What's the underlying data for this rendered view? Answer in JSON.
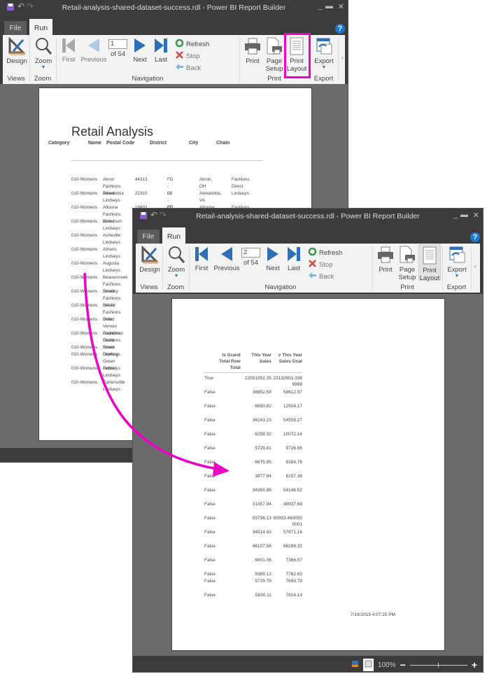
{
  "colors": {
    "accent": "#ee00c8",
    "nav_blue": "#2f6fb5",
    "chrome": "#3b3b3b",
    "ribbon": "#f3f3f3"
  },
  "back": {
    "title": "Retail-analysis-shared-dataset-success.rdl  -  Power  BI  Report  Builder",
    "tabs": {
      "file": "File",
      "run": "Run"
    },
    "ribbon": {
      "design": "Design",
      "zoom": "Zoom",
      "first": "First",
      "previous": "Previous",
      "page": "1",
      "of": "of  54",
      "next": "Next",
      "last": "Last",
      "refresh": "Refresh",
      "stop": "Stop",
      "back": "Back",
      "print": "Print",
      "page_setup": "Page\nSetup",
      "print_layout": "Print\nLayout",
      "export": "Export",
      "groups": {
        "views": "Views",
        "zoom": "Zoom",
        "navigation": "Navigation",
        "print": "Print",
        "export": "Export"
      }
    },
    "report": {
      "title": "Retail Analysis",
      "headers": [
        "Category",
        "Name",
        "Postal Code",
        "District",
        "City",
        "Chain"
      ],
      "rows": [
        [
          "010-Womens",
          "Akron\nFashions Direct",
          "44313",
          "FD - 03",
          "Akron, OH",
          "Fashions Direct"
        ],
        [
          "010-Womens",
          "Alexandria\nLindseys",
          "22310",
          "LI - 02",
          "Alexandria, VA",
          "Lindseys"
        ],
        [
          "010-Womens",
          "Altoona\nFashions Direct",
          "16602",
          "FD - 01",
          "Altoona, PA",
          "Fashions Direct"
        ],
        [
          "010-Womens",
          "Anderson\nLindseys"
        ],
        [
          "010-Womens",
          "Asheville\nLindseys"
        ],
        [
          "010-Womens",
          "Athens\nLindseys"
        ],
        [
          "010-Womens",
          "Augusta\nLindseys"
        ],
        [
          "010-Womens",
          "Beavercreek\nFashions Direct"
        ],
        [
          "010-Womens",
          "Beckley\nFashions Direct"
        ],
        [
          "010-Womens",
          "Bel Air\nFashions Direct"
        ],
        [
          "010-Womens",
          "Belle Vernon\nFashions Direct"
        ],
        [
          "010-Womens",
          "Boardman\nFashions Direct"
        ],
        [
          "010-Womens",
          "Bowie Lindseys"
        ],
        [
          "010-Womens",
          "Bowling Green\nLindseys"
        ],
        [
          "010-Womens",
          "Buford\nLindseys"
        ],
        [
          "010-Womens",
          "Cartersville\nLindseys"
        ]
      ]
    }
  },
  "front": {
    "title": "Retail-analysis-shared-dataset-success.rdl  -  Power  BI  Report  Builder",
    "tabs": {
      "file": "File",
      "run": "Run"
    },
    "ribbon": {
      "design": "Design",
      "zoom": "Zoom",
      "first": "First",
      "previous": "Previous",
      "page": "2",
      "of": "of  54",
      "next": "Next",
      "last": "Last",
      "refresh": "Refresh",
      "stop": "Stop",
      "back": "Back",
      "print": "Print",
      "page_setup": "Page\nSetup",
      "print_layout": "Print\nLayout",
      "export": "Export",
      "groups": {
        "views": "Views",
        "zoom": "Zoom",
        "navigation": "Navigation",
        "print": "Print",
        "export": "Export"
      }
    },
    "report": {
      "headers": [
        "Is Grand\nTotal Row\nTotal",
        "This Year\nSales",
        "v This Year\nSales Goal"
      ],
      "rows": [
        [
          "True",
          "22051952.35",
          "23132601.339\n9999"
        ],
        [
          "False",
          "38852.59",
          "58612.97"
        ],
        [
          "False",
          "6650.82",
          "12904.17"
        ],
        [
          "False",
          "36243.23",
          "54559.27"
        ],
        [
          "False",
          "6258.32",
          "10072.14"
        ],
        [
          "False",
          "5729.81",
          "9726.66"
        ],
        [
          "False",
          "6675.85",
          "9184.76"
        ],
        [
          "False",
          "3877.84",
          "8157.38"
        ],
        [
          "False",
          "34365.96",
          "54146.52"
        ],
        [
          "False",
          "31357.94",
          "48937.69"
        ],
        [
          "False",
          "55736.13",
          "80993.460000\n0001"
        ],
        [
          "False",
          "34514.43",
          "57871.16"
        ],
        [
          "False",
          "46107.56",
          "68288.32"
        ],
        [
          "False",
          "6801.06",
          "7366.57"
        ],
        [
          "False",
          "5989.12",
          "7762.63"
        ],
        [
          "False",
          "5725.79",
          "7693.79"
        ],
        [
          "False",
          "5830.11",
          "7814.14"
        ]
      ],
      "timestamp": "7/19/2019 4:07:25 PM"
    },
    "status": {
      "zoom": "100%"
    }
  }
}
